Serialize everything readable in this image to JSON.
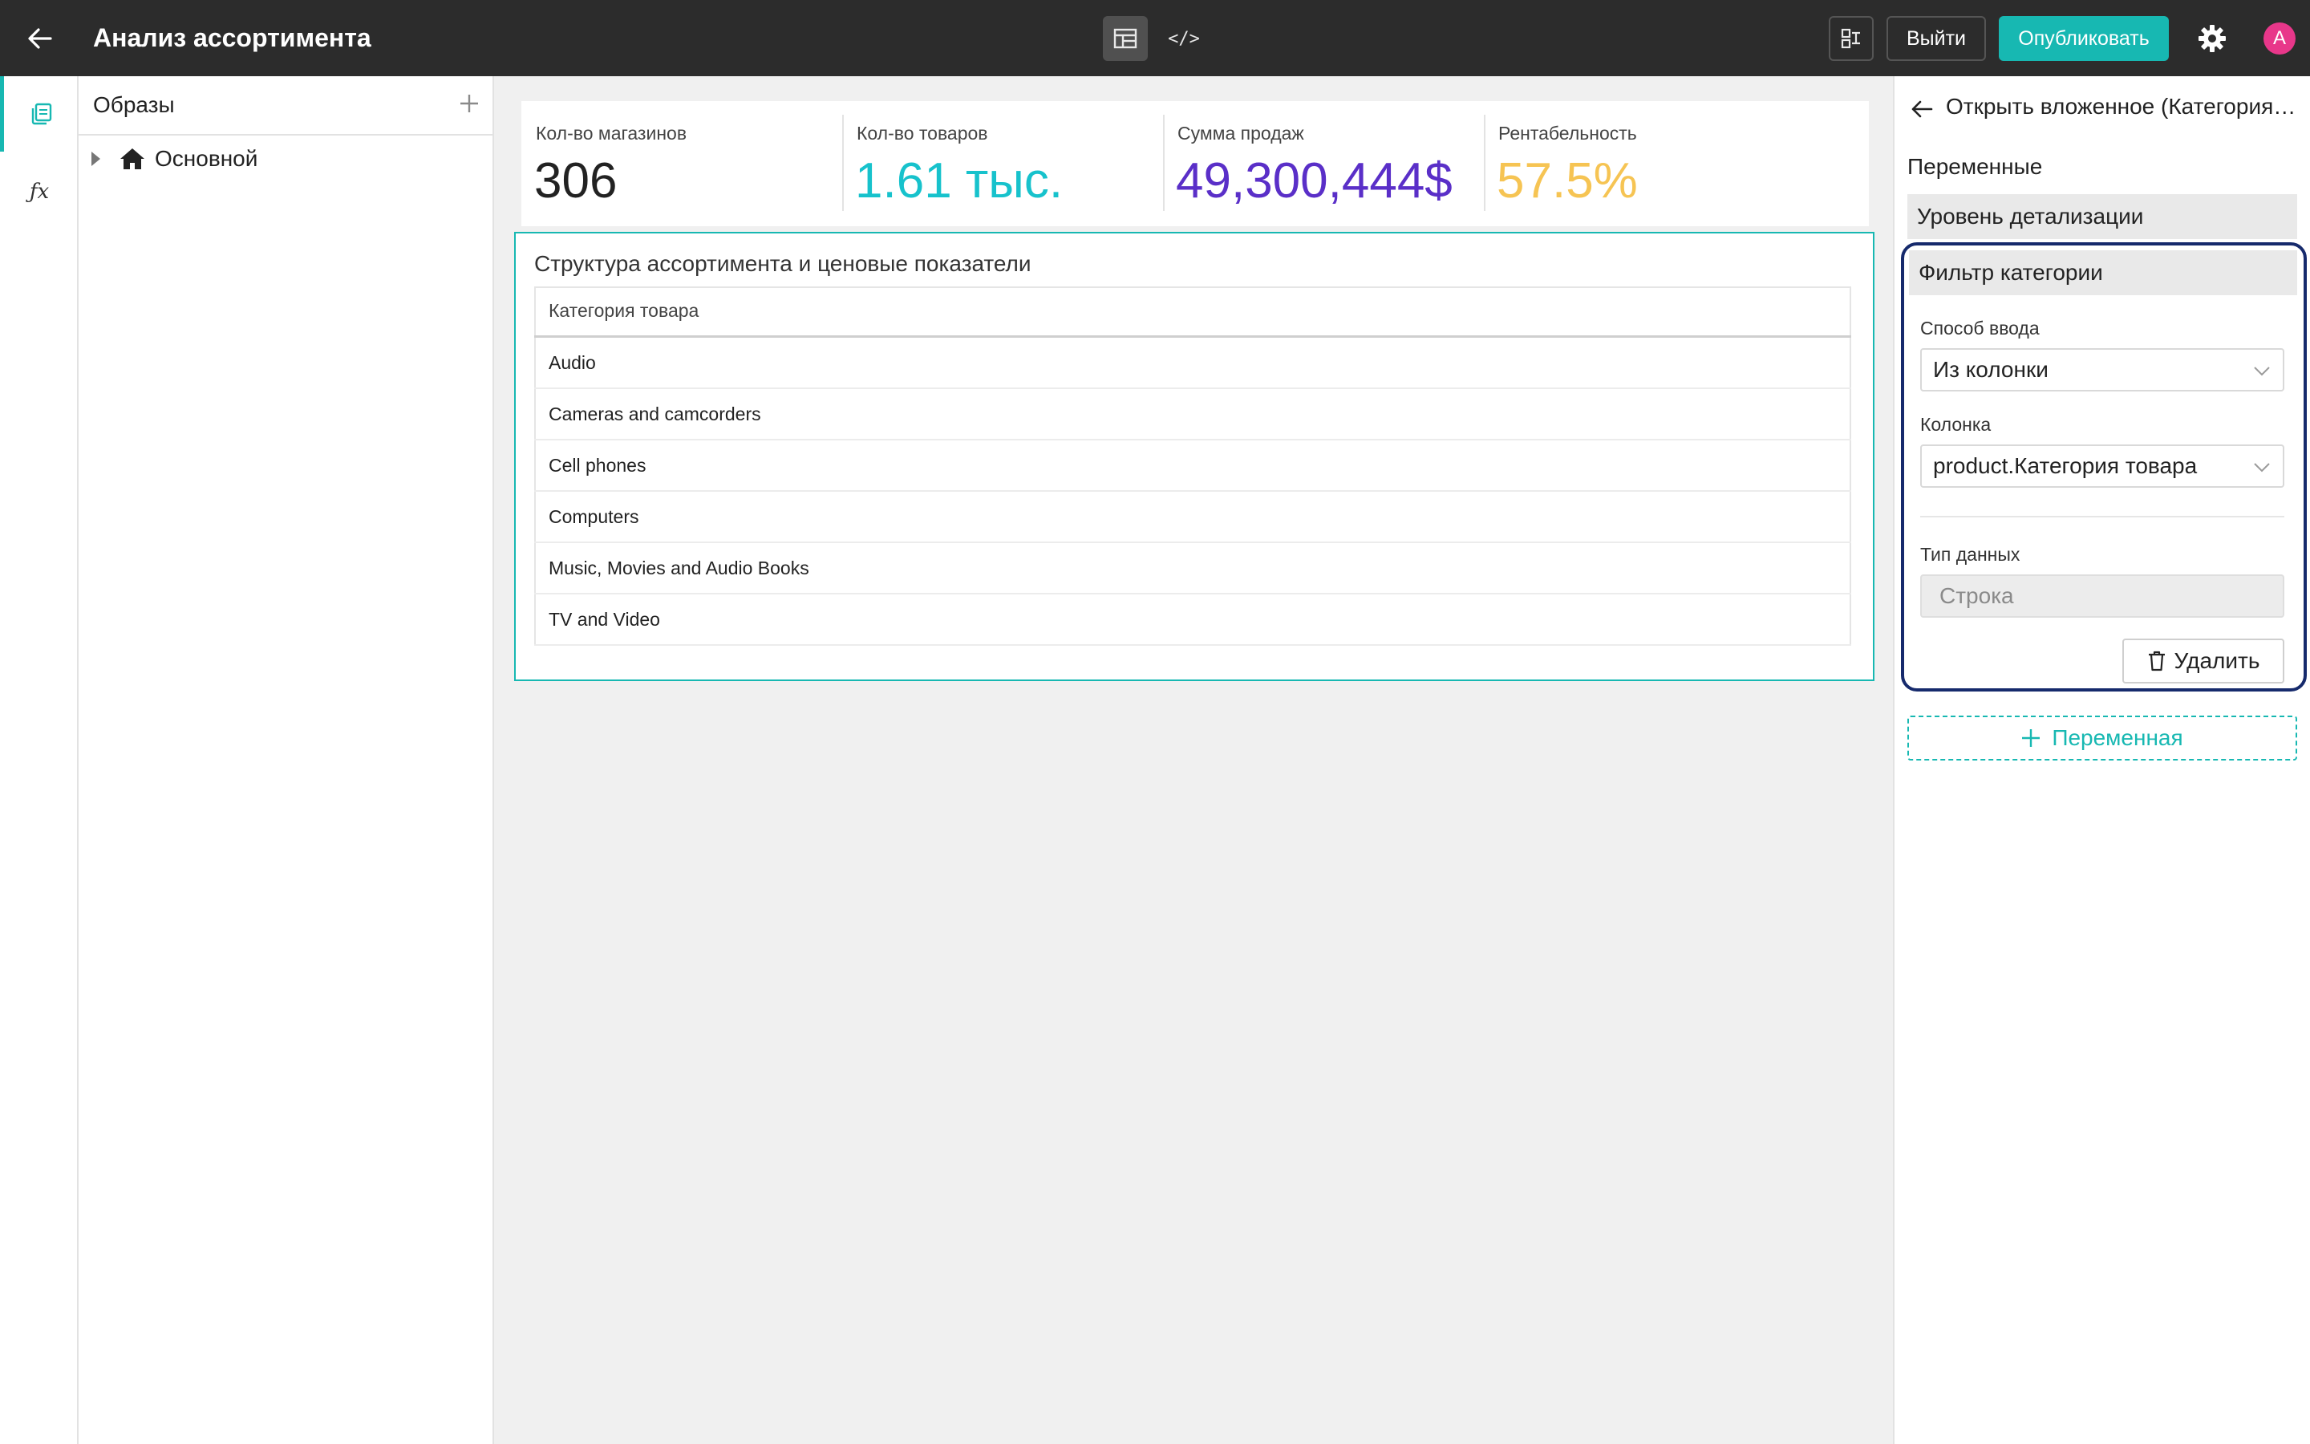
{
  "header": {
    "title": "Анализ ассортимента",
    "code_mode_label": "</>",
    "exit_label": "Выйти",
    "publish_label": "Опубликовать",
    "avatar_letter": "A",
    "accent_color": "#17b8b2"
  },
  "rail": {
    "items": [
      {
        "icon": "pages-icon",
        "active": true
      },
      {
        "icon": "fx-icon",
        "label": "ƒx"
      }
    ]
  },
  "pages_panel": {
    "title": "Образы",
    "tree": [
      {
        "label": "Основной",
        "icon": "home-icon",
        "expanded": false
      }
    ]
  },
  "kpis": [
    {
      "label": "Кол-во магазинов",
      "value": "306",
      "color": "#222222"
    },
    {
      "label": "Кол-во товаров",
      "value": "1.61 тыс.",
      "color": "#17c2cc"
    },
    {
      "label": "Сумма продаж",
      "value": "49,300,444$",
      "color": "#5a2fc8"
    },
    {
      "label": "Рентабельность",
      "value": "57.5%",
      "color": "#f6c453"
    }
  ],
  "table": {
    "title": "Структура ассортимента и ценовые показатели",
    "columns": [
      "Категория товара"
    ],
    "rows": [
      "Audio",
      "Cameras and camcorders",
      "Cell phones",
      "Computers",
      "Music, Movies and Audio Books",
      "TV and Video"
    ]
  },
  "right_panel": {
    "title": "Открыть вложенное (Категория товара)",
    "variables_title": "Переменные",
    "variables": [
      {
        "name": "Уровень детализации",
        "expanded": false
      },
      {
        "name": "Фильтр категории",
        "expanded": true,
        "input_method_label": "Способ ввода",
        "input_method_value": "Из колонки",
        "column_label": "Колонка",
        "column_value": "product.Категория товара",
        "data_type_label": "Тип данных",
        "data_type_value": "Строка",
        "delete_label": "Удалить"
      }
    ],
    "add_variable_label": "Переменная"
  }
}
